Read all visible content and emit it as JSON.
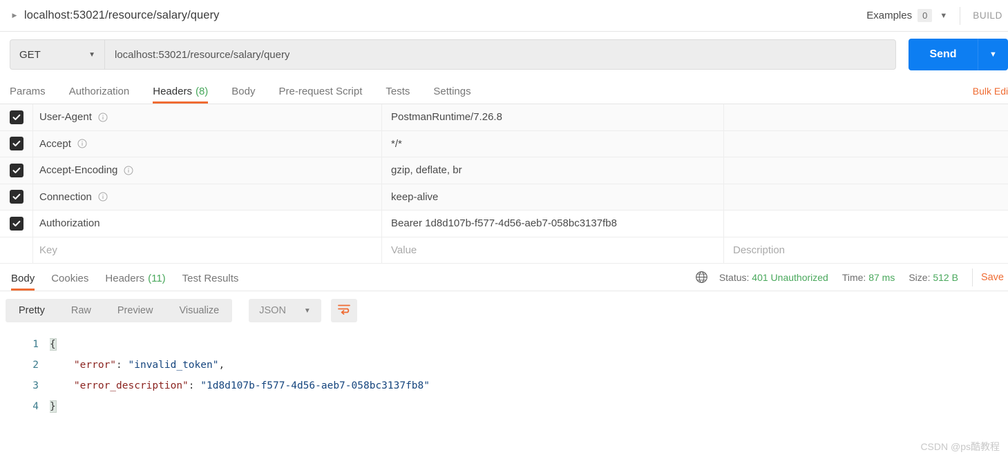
{
  "topbar": {
    "breadcrumb_title": "localhost:53021/resource/salary/query",
    "caret_icon": "triangle-right-icon",
    "examples_label": "Examples",
    "examples_count": "0",
    "examples_caret_icon": "chevron-down-icon",
    "build_label": "BUILD"
  },
  "request": {
    "method": "GET",
    "method_caret_icon": "chevron-down-icon",
    "url": "localhost:53021/resource/salary/query",
    "send_label": "Send",
    "send_caret_icon": "chevron-down-icon"
  },
  "request_tabs": [
    {
      "label": "Params",
      "count": "",
      "active": false
    },
    {
      "label": "Authorization",
      "count": "",
      "active": false
    },
    {
      "label": "Headers",
      "count": "(8)",
      "active": true
    },
    {
      "label": "Body",
      "count": "",
      "active": false
    },
    {
      "label": "Pre-request Script",
      "count": "",
      "active": false
    },
    {
      "label": "Tests",
      "count": "",
      "active": false
    },
    {
      "label": "Settings",
      "count": "",
      "active": false
    }
  ],
  "bulk_edit_label": "Bulk Edit",
  "headers_table": {
    "placeholder_key": "Key",
    "placeholder_value": "Value",
    "placeholder_description": "Description",
    "rows": [
      {
        "checked": true,
        "key": "User-Agent",
        "value": "PostmanRuntime/7.26.8",
        "description": "",
        "info": true,
        "shaded": true
      },
      {
        "checked": true,
        "key": "Accept",
        "value": "*/*",
        "description": "",
        "info": true,
        "shaded": true
      },
      {
        "checked": true,
        "key": "Accept-Encoding",
        "value": "gzip, deflate, br",
        "description": "",
        "info": true,
        "shaded": true
      },
      {
        "checked": true,
        "key": "Connection",
        "value": "keep-alive",
        "description": "",
        "info": true,
        "shaded": true
      },
      {
        "checked": true,
        "key": "Authorization",
        "value": "Bearer 1d8d107b-f577-4d56-aeb7-058bc3137fb8",
        "description": "",
        "info": false,
        "shaded": false
      }
    ]
  },
  "response_tabs": [
    {
      "label": "Body",
      "count": "",
      "active": true
    },
    {
      "label": "Cookies",
      "count": "",
      "active": false
    },
    {
      "label": "Headers",
      "count": "(11)",
      "active": false
    },
    {
      "label": "Test Results",
      "count": "",
      "active": false
    }
  ],
  "response_meta": {
    "globe_icon": "globe-icon",
    "status_label": "Status:",
    "status_value": "401 Unauthorized",
    "time_label": "Time:",
    "time_value": "87 ms",
    "size_label": "Size:",
    "size_value": "512 B",
    "save_label": "Save"
  },
  "format_bar": {
    "buttons": [
      {
        "label": "Pretty",
        "active": true
      },
      {
        "label": "Raw",
        "active": false
      },
      {
        "label": "Preview",
        "active": false
      },
      {
        "label": "Visualize",
        "active": false
      }
    ],
    "language": "JSON",
    "language_caret_icon": "chevron-down-icon",
    "wrap_icon": "word-wrap-icon"
  },
  "response_body": {
    "line_numbers": [
      "1",
      "2",
      "3",
      "4"
    ],
    "lines": [
      {
        "indent": "",
        "open_brace": "{"
      },
      {
        "indent": "    ",
        "key": "\"error\"",
        "colon": ": ",
        "value": "\"invalid_token\"",
        "comma": ","
      },
      {
        "indent": "    ",
        "key": "\"error_description\"",
        "colon": ": ",
        "value": "\"1d8d107b-f577-4d56-aeb7-058bc3137fb8\"",
        "comma": ""
      },
      {
        "indent": "",
        "close_brace": "}"
      }
    ]
  },
  "watermark": "CSDN @ps酷教程",
  "colors": {
    "accent_orange": "#ef6c33",
    "send_blue": "#0d7ef2",
    "status_green": "#49a85c",
    "json_key": "#8b2420",
    "json_string": "#15457e"
  }
}
